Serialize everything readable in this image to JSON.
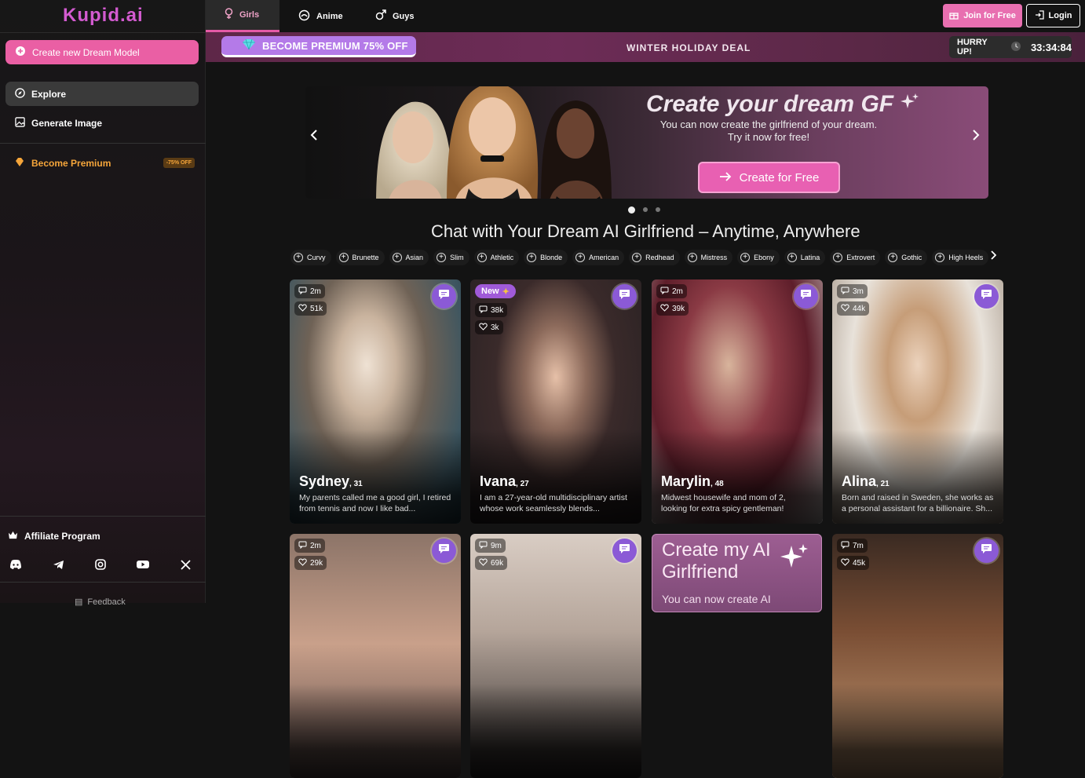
{
  "sidebar": {
    "logo": "Kupid.ai",
    "create_label": "Create new Dream Model",
    "explore_label": "Explore",
    "generate_label": "Generate Image",
    "premium_label": "Become Premium",
    "premium_badge": "-75% OFF",
    "affiliate_label": "Affiliate Program",
    "socials": [
      "discord-icon",
      "telegram-icon",
      "instagram-icon",
      "youtube-icon",
      "x-icon"
    ],
    "feedback_label": "Feedback"
  },
  "topbar": {
    "tabs": [
      {
        "label": "Girls",
        "icon": "female-icon"
      },
      {
        "label": "Anime",
        "icon": "anime-icon"
      },
      {
        "label": "Guys",
        "icon": "male-icon"
      }
    ],
    "join_label": "Join for Free",
    "login_label": "Login"
  },
  "promo": {
    "badge_label": "BECOME PREMIUM 75% OFF",
    "deal_label": "WINTER HOLIDAY DEAL",
    "hurry_label": "HURRY UP!",
    "timer": "33:34:84"
  },
  "hero": {
    "title": "Create your dream GF",
    "subtitle_line1": "You can now create the girlfriend of your dream.",
    "subtitle_line2": "Try it now for free!",
    "cta_label": "Create for Free",
    "slides": 3,
    "active_slide": 1
  },
  "main": {
    "heading": "Chat with Your Dream AI Girlfriend – Anytime, Anywhere",
    "tags": [
      "Curvy",
      "Brunette",
      "Asian",
      "Slim",
      "Athletic",
      "Blonde",
      "American",
      "Redhead",
      "Mistress",
      "Ebony",
      "Latina",
      "Extrovert",
      "Gothic",
      "High Heels"
    ]
  },
  "cards": [
    {
      "time": "2m",
      "likes": "51k",
      "name": "Sydney",
      "age": ", 31",
      "desc": "My parents called me a good girl, I retired from tennis and now I like bad...",
      "new": ""
    },
    {
      "time": "38k",
      "likes": "3k",
      "name": "Ivana",
      "age": ", 27",
      "desc": "I am a 27-year-old multidisciplinary artist whose work seamlessly blends...",
      "new": "New"
    },
    {
      "time": "2m",
      "likes": "39k",
      "name": "Marylin",
      "age": ", 48",
      "desc": "Midwest housewife and mom of 2, looking for extra spicy gentleman!",
      "new": ""
    },
    {
      "time": "3m",
      "likes": "44k",
      "name": "Alina",
      "age": ", 21",
      "desc": "Born and raised in Sweden, she works as a personal assistant for a billionaire. Sh...",
      "new": ""
    },
    {
      "time": "2m",
      "likes": "29k"
    },
    {
      "time": "9m",
      "likes": "69k"
    },
    {
      "time": "7m",
      "likes": "45k"
    }
  ],
  "cta_card": {
    "title_line1": "Create my AI",
    "title_line2": "Girlfriend",
    "subtitle": "You can now create AI"
  },
  "colors": {
    "accent": "#e860b2",
    "logo": "#d35bd0",
    "premium": "#f5a53a",
    "chat_button": "#8b5ad6"
  }
}
